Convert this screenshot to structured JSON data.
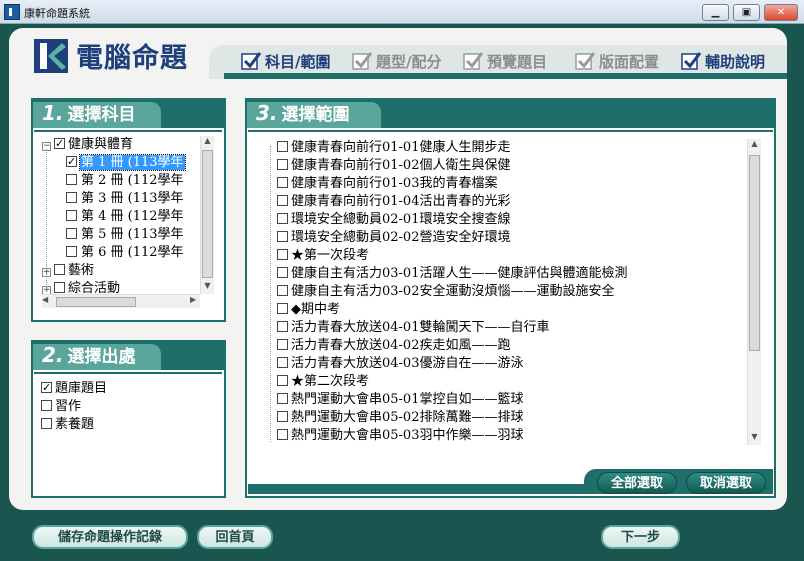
{
  "window": {
    "title": "康軒命題系統",
    "minimize": "▁",
    "restore": "▣",
    "close": "✕"
  },
  "header": {
    "app_title": "電腦命題",
    "steps": [
      {
        "label": "科目/範圍",
        "active": true
      },
      {
        "label": "題型/配分",
        "active": false
      },
      {
        "label": "預覽題目",
        "active": false
      },
      {
        "label": "版面配置",
        "active": false
      },
      {
        "label": "輔助說明",
        "active": true
      }
    ]
  },
  "colors": {
    "accent": "#1e6f6a",
    "title": "#1f3f7a",
    "step_active": "#1f3f7a",
    "step_inactive": "#8d8d8d",
    "selected_bg": "#3399ff"
  },
  "subject_panel": {
    "number": "1.",
    "title": "選擇科目",
    "tree": [
      {
        "label": "健康與體育",
        "expanded": true,
        "checked": true,
        "children": [
          {
            "label": "第 1 冊 (113學年",
            "checked": true,
            "selected": true
          },
          {
            "label": "第 2 冊 (112學年",
            "checked": false
          },
          {
            "label": "第 3 冊 (113學年",
            "checked": false
          },
          {
            "label": "第 4 冊 (112學年",
            "checked": false
          },
          {
            "label": "第 5 冊 (113學年",
            "checked": false
          },
          {
            "label": "第 6 冊 (112學年",
            "checked": false
          }
        ]
      },
      {
        "label": "藝術",
        "expanded": false,
        "checked": false
      },
      {
        "label": "綜合活動",
        "expanded": false,
        "checked": false
      }
    ]
  },
  "source_panel": {
    "number": "2.",
    "title": "選擇出處",
    "items": [
      {
        "label": "題庫題目",
        "checked": true
      },
      {
        "label": "習作",
        "checked": false
      },
      {
        "label": "素養題",
        "checked": false
      }
    ]
  },
  "range_panel": {
    "number": "3.",
    "title": "選擇範圍",
    "items": [
      {
        "label": "健康青春向前行01-01健康人生開步走"
      },
      {
        "label": "健康青春向前行01-02個人衛生與保健"
      },
      {
        "label": "健康青春向前行01-03我的青春檔案"
      },
      {
        "label": "健康青春向前行01-04活出青春的光彩"
      },
      {
        "label": "環境安全總動員02-01環境安全搜查線"
      },
      {
        "label": "環境安全總動員02-02營造安全好環境"
      },
      {
        "label": "★第一次段考"
      },
      {
        "label": "健康自主有活力03-01活躍人生——健康評估與體適能檢測"
      },
      {
        "label": "健康自主有活力03-02安全運動沒煩惱——運動設施安全"
      },
      {
        "label": "◆期中考"
      },
      {
        "label": "活力青春大放送04-01雙輪闖天下——自行車"
      },
      {
        "label": "活力青春大放送04-02疾走如風——跑"
      },
      {
        "label": "活力青春大放送04-03優游自在——游泳"
      },
      {
        "label": "★第二次段考"
      },
      {
        "label": "熱門運動大會串05-01掌控自如——籃球"
      },
      {
        "label": "熱門運動大會串05-02排除萬難——排球"
      },
      {
        "label": "熱門運動大會串05-03羽中作樂——羽球"
      }
    ],
    "select_all": "全部選取",
    "deselect_all": "取消選取"
  },
  "footer": {
    "save_log": "儲存命題操作記錄",
    "home": "回首頁",
    "next": "下一步"
  }
}
